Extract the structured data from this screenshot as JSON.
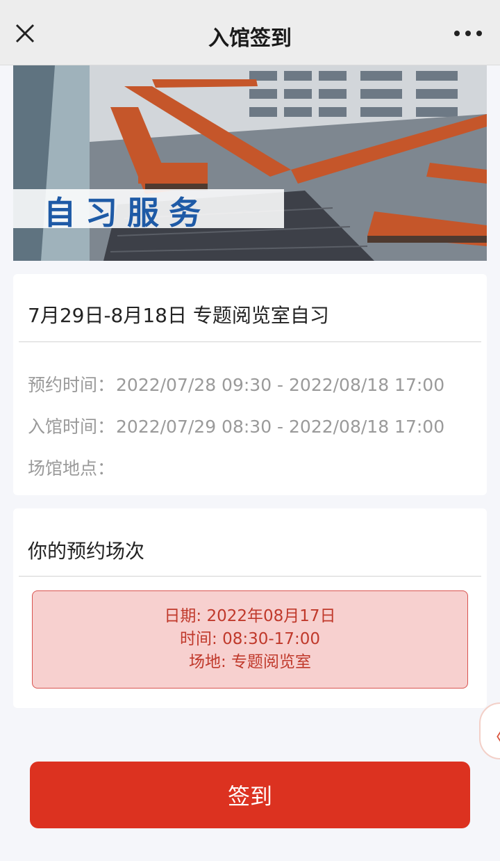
{
  "nav": {
    "title": "入馆签到",
    "close_icon": "close-icon",
    "more_icon": "more-icon"
  },
  "banner": {
    "text": "自习服务"
  },
  "activity": {
    "title": "7月29日-8月18日 专题阅览室自习",
    "booking_label": "预约时间：",
    "booking_value": "2022/07/28 09:30 - 2022/08/18 17:00",
    "entry_label": "入馆时间：",
    "entry_value": "2022/07/29 08:30 - 2022/08/18 17:00",
    "venue_label": "场馆地点：",
    "venue_value": ""
  },
  "reservation": {
    "title": "你的预约场次",
    "date_line": "日期: 2022年08月17日",
    "time_line": "时间: 08:30-17:00",
    "place_line": "场地: 专题阅览室"
  },
  "side_tab": {
    "icon": "chevron-left-icon",
    "glyph": "〈"
  },
  "checkin_button": "签到",
  "colors": {
    "accent": "#dc3220",
    "slot_bg": "#f7d0cf",
    "slot_text": "#c0392b",
    "banner_text": "#1e5aa6"
  }
}
